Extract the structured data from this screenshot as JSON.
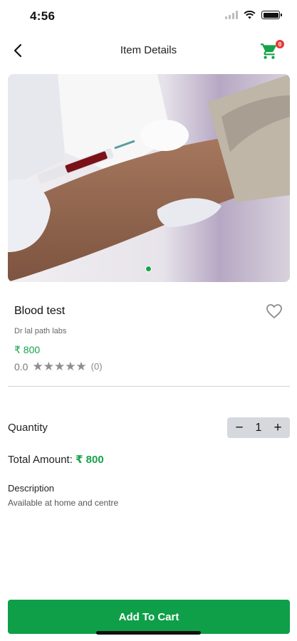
{
  "status_bar": {
    "time": "4:56"
  },
  "header": {
    "title": "Item Details",
    "cart_badge_count": "0"
  },
  "carousel": {
    "total_slides": 1,
    "active_slide": 1
  },
  "product": {
    "name": "Blood test",
    "vendor": "Dr lal path labs",
    "price": "₹ 800",
    "rating_value": "0.0",
    "stars": "★★★★★",
    "rating_count": "(0)"
  },
  "quantity": {
    "label": "Quantity",
    "minus": "−",
    "value": "1",
    "plus": "+"
  },
  "total": {
    "label": "Total Amount:",
    "amount": "₹ 800"
  },
  "description": {
    "title": "Description",
    "text": "Available at home and centre"
  },
  "actions": {
    "add_to_cart_label": "Add To Cart"
  },
  "colors": {
    "accent": "#16a34a",
    "button": "#0f9f48",
    "badge": "#e53935"
  }
}
